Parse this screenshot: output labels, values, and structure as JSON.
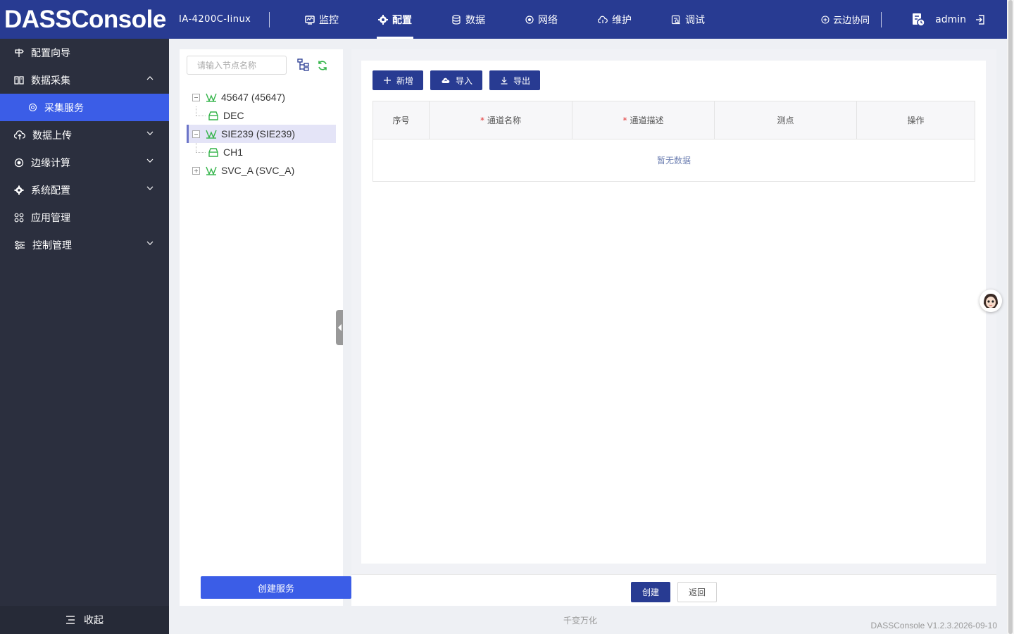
{
  "app": {
    "logo": "DASSConsole",
    "device": "IA-4200C-linux",
    "nav": [
      {
        "label": "监控",
        "icon": "monitor-icon"
      },
      {
        "label": "配置",
        "icon": "config-icon",
        "active": true
      },
      {
        "label": "数据",
        "icon": "database-icon"
      },
      {
        "label": "网络",
        "icon": "network-icon"
      },
      {
        "label": "维护",
        "icon": "cloud-maintain-icon"
      },
      {
        "label": "调试",
        "icon": "debug-icon"
      }
    ],
    "cloud_label": "云边协同",
    "user": "admin"
  },
  "sidebar": {
    "items": [
      {
        "label": "配置向导"
      },
      {
        "label": "数据采集",
        "expanded": true
      },
      {
        "label": "采集服务",
        "selected": true
      },
      {
        "label": "数据上传"
      },
      {
        "label": "边缘计算"
      },
      {
        "label": "系统配置"
      },
      {
        "label": "应用管理"
      },
      {
        "label": "控制管理"
      }
    ],
    "collapse_label": "收起"
  },
  "tree": {
    "search_placeholder": "请输入节点名称",
    "nodes": [
      {
        "label": "45647 (45647)",
        "expanded": true
      },
      {
        "label": "DEC"
      },
      {
        "label": "SIE239 (SIE239)",
        "expanded": true,
        "selected": true
      },
      {
        "label": "CH1"
      },
      {
        "label": "SVC_A (SVC_A)",
        "expanded": false
      }
    ],
    "create_service": "创建服务"
  },
  "main": {
    "toolbar": {
      "add": "新增",
      "import": "导入",
      "export": "导出"
    },
    "table": {
      "columns": [
        "序号",
        "通道名称",
        "通道描述",
        "测点",
        "操作"
      ],
      "required": [
        false,
        true,
        true,
        false,
        false
      ],
      "empty_text": "暂无数据"
    },
    "footer": {
      "create": "创建",
      "back": "返回"
    }
  },
  "page_footer": "千变万化",
  "version": "DASSConsole V1.2.3.2026-09-10",
  "colors": {
    "header": "#283b92",
    "sidebar": "#2b2f3e",
    "accent": "#3b5de7",
    "tree_icon": "#33b449"
  }
}
